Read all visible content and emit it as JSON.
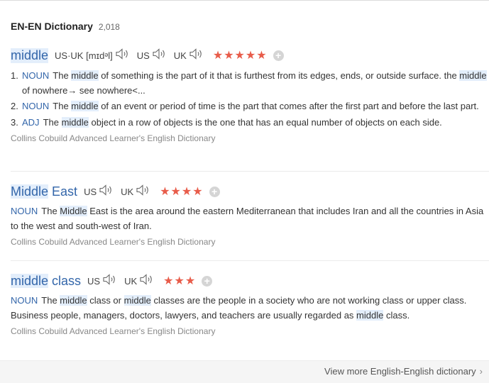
{
  "header": {
    "title": "EN-EN Dictionary",
    "count": "2,018"
  },
  "entries": [
    {
      "headword": "middle",
      "pronunciation": [
        {
          "label": "US·UK [mɪdᵊl]"
        },
        {
          "label": "US"
        },
        {
          "label": "UK"
        }
      ],
      "rating": 5,
      "stars": "★★★★★",
      "senses": [
        {
          "num": "1.",
          "pos": "NOUN",
          "parts": [
            "The ",
            "middle",
            " of something is the part of it that is furthest from its edges, ends, or outside surface. the ",
            "middle",
            " of nowhere→ see nowhere<..."
          ]
        },
        {
          "num": "2.",
          "pos": "NOUN",
          "parts": [
            "The ",
            "middle",
            " of an event or period of time is the part that comes after the first part and before the last part."
          ]
        },
        {
          "num": "3.",
          "pos": "ADJ",
          "parts": [
            "The ",
            "middle",
            " object in a row of objects is the one that has an equal number of objects on each side."
          ]
        }
      ],
      "source": "Collins Cobuild Advanced Learner's English Dictionary"
    },
    {
      "headword_parts": [
        "Middle",
        " East"
      ],
      "pronunciation": [
        {
          "label": "US"
        },
        {
          "label": "UK"
        }
      ],
      "rating": 4,
      "stars": "★★★★",
      "senses": [
        {
          "pos": "NOUN",
          "parts": [
            "The ",
            "Middle",
            " East is the area around the eastern Mediterranean that includes Iran and all the countries in Asia to the west and south-west of Iran."
          ]
        }
      ],
      "source": "Collins Cobuild Advanced Learner's English Dictionary"
    },
    {
      "headword_parts": [
        "middle",
        " class"
      ],
      "pronunciation": [
        {
          "label": "US"
        },
        {
          "label": "UK"
        }
      ],
      "rating": 3,
      "stars": "★★★",
      "senses": [
        {
          "pos": "NOUN",
          "parts": [
            "The ",
            "middle",
            " class or ",
            "middle",
            " classes are the people in a society who are not working class or upper class. Business people, managers, doctors, lawyers, and teachers are usually regarded as ",
            "middle",
            " class."
          ]
        }
      ],
      "source": "Collins Cobuild Advanced Learner's English Dictionary"
    }
  ],
  "plus_label": "+",
  "footer": {
    "more_label": "View more English-English dictionary",
    "chevron": "›"
  },
  "icons": {
    "speaker": "speaker-icon",
    "plus": "add-icon",
    "chevron": "chevron-right-icon"
  },
  "colors": {
    "headword": "#3366aa",
    "pos": "#3366aa",
    "stars": "#e85c4a",
    "highlight": "#e3eefb"
  }
}
